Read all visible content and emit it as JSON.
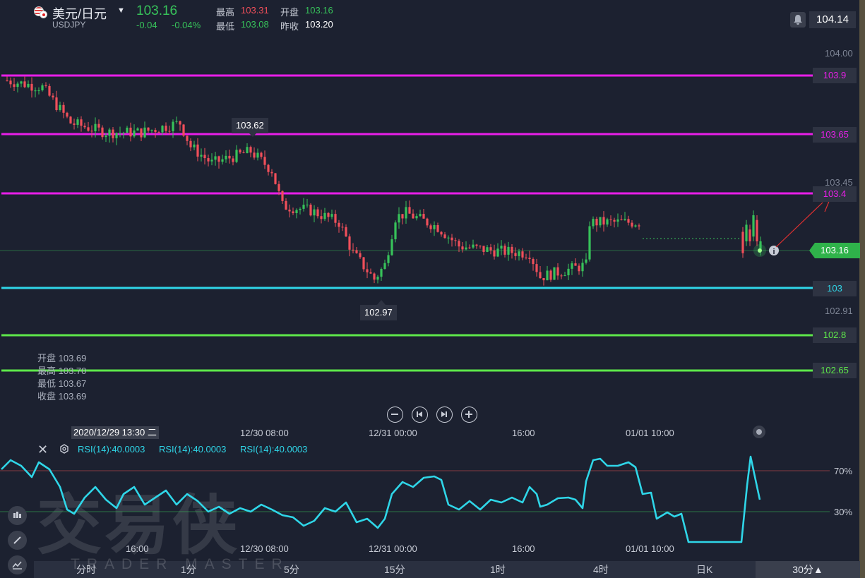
{
  "header": {
    "pair_name": "美元/日元",
    "pair_code": "USDJPY",
    "last_price": "103.16",
    "change": "-0.04",
    "change_pct": "-0.04%",
    "high_label": "最高",
    "high_value": "103.31",
    "open_label": "开盘",
    "open_value": "103.16",
    "low_label": "最低",
    "low_value": "103.08",
    "prev_close_label": "昨收",
    "prev_close_value": "103.20",
    "top_right_price": "104.14"
  },
  "price_axis": {
    "labels": [
      "104.00",
      "103.45",
      "102.91"
    ]
  },
  "horizontal_lines": [
    {
      "value": "103.9",
      "color": "#e81ee8"
    },
    {
      "value": "103.65",
      "color": "#e81ee8"
    },
    {
      "value": "103.4",
      "color": "#e81ee8"
    },
    {
      "value": "103",
      "color": "#2fd6e8"
    },
    {
      "value": "102.8",
      "color": "#5ee84a"
    },
    {
      "value": "102.65",
      "color": "#5ee84a"
    }
  ],
  "current_price_tag": "103.16",
  "peak_high_label": "103.62",
  "peak_low_label": "102.97",
  "ohlc": {
    "open": "开盘 103.69",
    "high": "最高 103.70",
    "low": "最低 103.67",
    "close": "收盘 103.69"
  },
  "time_axis": {
    "selected": "2020/12/29 13:30 二",
    "labels": [
      "12/30 08:00",
      "12/31 00:00",
      "16:00",
      "01/01 10:00"
    ],
    "rsi_labels": [
      "16:00",
      "12/30 08:00",
      "12/31 00:00",
      "16:00",
      "01/01 10:00"
    ]
  },
  "rsi": {
    "labels": [
      "RSI(14):40.0003",
      "RSI(14):40.0003",
      "RSI(14):40.0003"
    ],
    "upper": "70%",
    "lower": "30%",
    "color": "#2fd6e8"
  },
  "watermark": {
    "cn": "交易侠",
    "en": "TRADER MASTER"
  },
  "periods": [
    "分时",
    "1分",
    "5分",
    "15分",
    "1时",
    "4时",
    "日K"
  ],
  "period_selected": "30分▲",
  "colors": {
    "up": "#37c25a",
    "down": "#f04f5a",
    "background": "#1c2130"
  }
}
